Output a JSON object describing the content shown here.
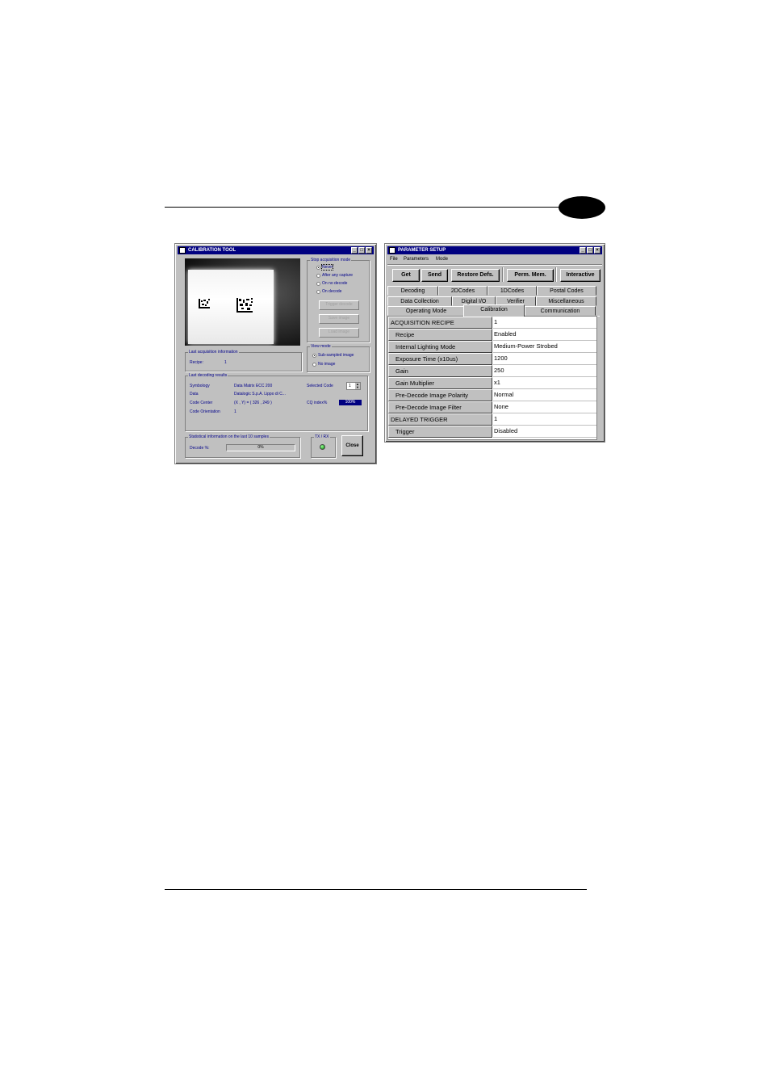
{
  "calibration": {
    "title": "CALIBRATION TOOL",
    "stop_mode": {
      "title": "Stop acquisition mode",
      "options": [
        "Never",
        "After any capture",
        "On no decode",
        "On decode"
      ],
      "selected": "Never"
    },
    "buttons": {
      "trigger": "Trigger decode",
      "save_image": "Save image",
      "load_image": "Load image"
    },
    "view_mode": {
      "title": "View mode",
      "options": [
        "Sub-sampled image",
        "No image"
      ],
      "selected": "Sub-sampled image"
    },
    "last_acq": {
      "title": "Last acquisition information",
      "recipe_label": "Recipe:",
      "recipe_value": "1"
    },
    "last_decode": {
      "title": "Last decoding results",
      "rows": [
        {
          "label": "Symbology",
          "value": "Data Matrix ECC 200"
        },
        {
          "label": "Data",
          "value": "Datalogic S.p.A. Lippo di C..."
        },
        {
          "label": "Code Center",
          "value": "(X , Y) = ( 326 , 249 )"
        },
        {
          "label": "Code Orientation",
          "value": "1"
        }
      ],
      "selected_code_label": "Selected Code",
      "selected_code_value": "1",
      "cq_label": "CQ index%",
      "cq_value": "100%"
    },
    "stats": {
      "title": "Statistical information on the last 10 samples",
      "decode_label": "Decode %:",
      "decode_value": "0%",
      "decode_fraction": 0
    },
    "txrx": {
      "title": "TX / RX"
    },
    "close_label": "Close"
  },
  "param": {
    "title": "PARAMETER SETUP",
    "menu": [
      "File",
      "Parameters",
      "Mode"
    ],
    "buttons": [
      "Get",
      "Send",
      "Restore Defs.",
      "Perm. Mem.",
      "Interactive"
    ],
    "tabs_row1": [
      "Decoding",
      "2DCodes",
      "1DCodes",
      "Postal Codes"
    ],
    "tabs_row2": [
      "Data Collection",
      "Digital I/O",
      "Verifier",
      "Miscellaneous"
    ],
    "tabs_row3": [
      "Operating Mode",
      "Calibration",
      "Communication"
    ],
    "active_tab": "Calibration",
    "rows": [
      {
        "name": "ACQUISITION RECIPE",
        "value": "1"
      },
      {
        "name": "Recipe",
        "value": "Enabled"
      },
      {
        "name": "Internal Lighting Mode",
        "value": "Medium-Power Strobed"
      },
      {
        "name": "Exposure Time (x10us)",
        "value": "1200"
      },
      {
        "name": "Gain",
        "value": "250"
      },
      {
        "name": "Gain Multiplier",
        "value": "x1"
      },
      {
        "name": "Pre-Decode Image Polarity",
        "value": "Normal"
      },
      {
        "name": "Pre-Decode Image Filter",
        "value": "None"
      },
      {
        "name": "DELAYED TRIGGER",
        "value": "1"
      },
      {
        "name": "Trigger",
        "value": "Disabled"
      }
    ]
  }
}
